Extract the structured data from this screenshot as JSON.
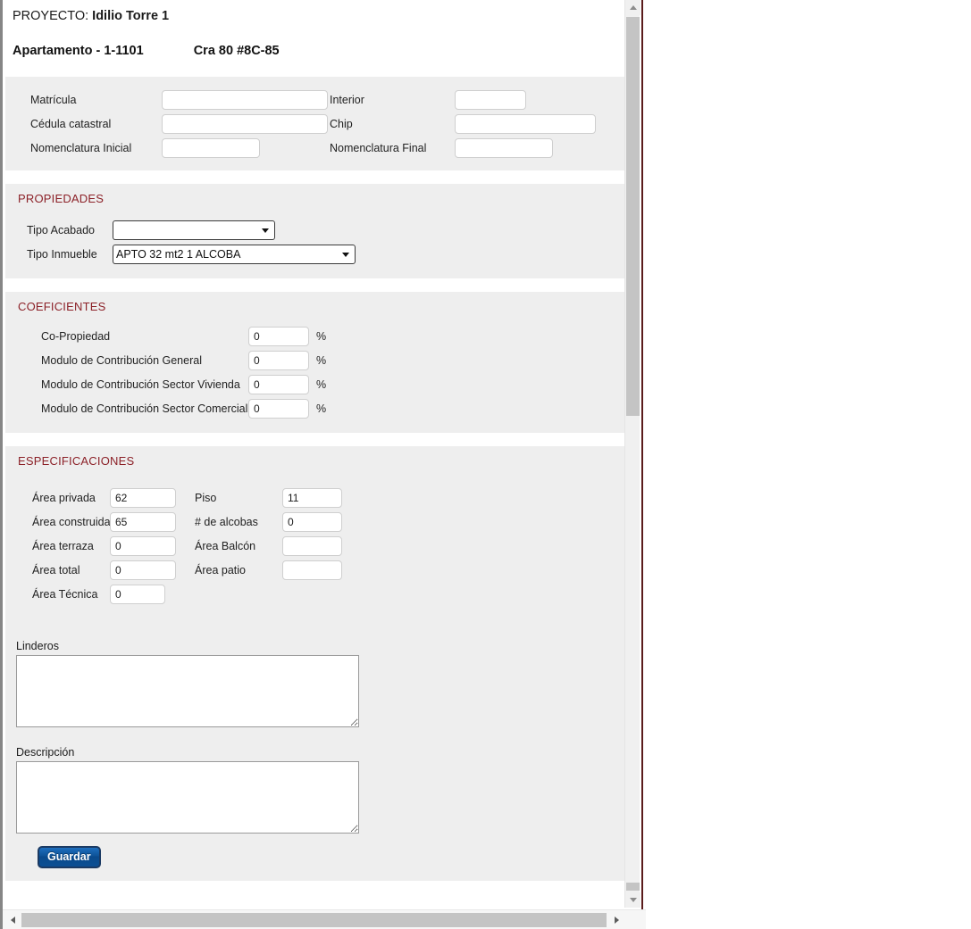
{
  "header": {
    "proyecto_label": "PROYECTO:",
    "proyecto_name": "Idilio Torre 1",
    "unidad": "Apartamento - 1-1101",
    "direccion": "Cra 80 #8C-85"
  },
  "identificacion": {
    "matricula": {
      "label": "Matrícula",
      "value": ""
    },
    "cedula_catastral": {
      "label": "Cédula catastral",
      "value": ""
    },
    "nomenclatura_inicial": {
      "label": "Nomenclatura Inicial",
      "value": ""
    },
    "interior": {
      "label": "Interior",
      "value": ""
    },
    "chip": {
      "label": "Chip",
      "value": ""
    },
    "nomenclatura_final": {
      "label": "Nomenclatura Final",
      "value": ""
    }
  },
  "propiedades": {
    "title": "PROPIEDADES",
    "tipo_acabado": {
      "label": "Tipo Acabado",
      "value": "",
      "options": [
        ""
      ]
    },
    "tipo_inmueble": {
      "label": "Tipo Inmueble",
      "value": "APTO 32 mt2 1 ALCOBA",
      "options": [
        "APTO 32 mt2 1 ALCOBA"
      ]
    }
  },
  "coeficientes": {
    "title": "COEFICIENTES",
    "unit": "%",
    "rows": [
      {
        "label": "Co-Propiedad",
        "value": "0"
      },
      {
        "label": "Modulo de Contribución General",
        "value": "0"
      },
      {
        "label": "Modulo de Contribución Sector Vivienda",
        "value": "0"
      },
      {
        "label": "Modulo de Contribución Sector Comercial",
        "value": "0"
      }
    ]
  },
  "especificaciones": {
    "title": "ESPECIFICACIONES",
    "left": [
      {
        "label": "Área privada",
        "value": "62"
      },
      {
        "label": "Área construida",
        "value": "65"
      },
      {
        "label": "Área terraza",
        "value": "0"
      },
      {
        "label": "Área total",
        "value": "0"
      },
      {
        "label": "Área Técnica",
        "value": "0"
      }
    ],
    "right": [
      {
        "label": "Piso",
        "value": "11"
      },
      {
        "label": "# de alcobas",
        "value": "0"
      },
      {
        "label": "Área Balcón",
        "value": ""
      },
      {
        "label": "Área patio",
        "value": ""
      }
    ]
  },
  "linderos": {
    "label": "Linderos",
    "value": ""
  },
  "descripcion": {
    "label": "Descripción",
    "value": ""
  },
  "actions": {
    "save_label": "Guardar"
  },
  "scrollbars": {
    "vertical_up": "scroll-up-arrow",
    "vertical_down": "scroll-down-arrow",
    "horizontal_left": "scroll-left-arrow",
    "horizontal_right": "scroll-right-arrow"
  },
  "colors": {
    "section_heading": "#8c2128",
    "panel_bg": "#eeeeee",
    "save_button": "#0d5297"
  }
}
